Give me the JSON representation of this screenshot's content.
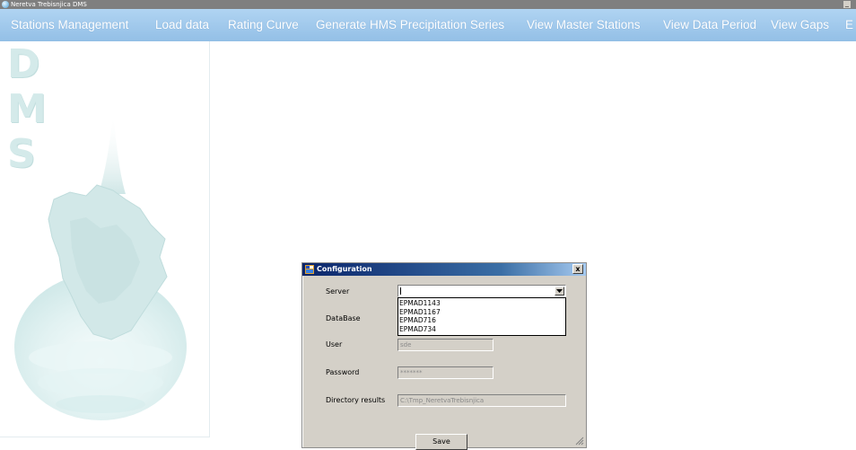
{
  "window": {
    "title": "Neretva Trebisnjica DMS",
    "minimize_label": "_"
  },
  "menu": {
    "items": [
      "Stations Management",
      "Load data",
      "Rating Curve",
      "Generate HMS Precipitation Series",
      "View Master Stations",
      "View Data Period",
      "View Gaps",
      "E"
    ]
  },
  "logo": {
    "letters": [
      "D",
      "M",
      "S"
    ]
  },
  "dialog": {
    "title": "Configuration",
    "close_label": "x",
    "server": {
      "label": "Server",
      "value": "",
      "options": [
        "EPMAD1143",
        "EPMAD1167",
        "EPMAD716",
        "EPMAD734"
      ]
    },
    "database": {
      "label": "DataBase"
    },
    "user": {
      "label": "User",
      "value": "sde"
    },
    "password": {
      "label": "Password",
      "value": "*******"
    },
    "directory": {
      "label": "Directory results",
      "value": "C:\\Tmp_NeretvaTrebisnjica"
    },
    "save_label": "Save"
  },
  "colors": {
    "menu_bar": "#93bfe6",
    "title_bar": "#7f7f7f",
    "dialog_caption": "#0a246a",
    "dialog_bg": "#d4d0c8",
    "logo_tint": "#d4eaea"
  }
}
